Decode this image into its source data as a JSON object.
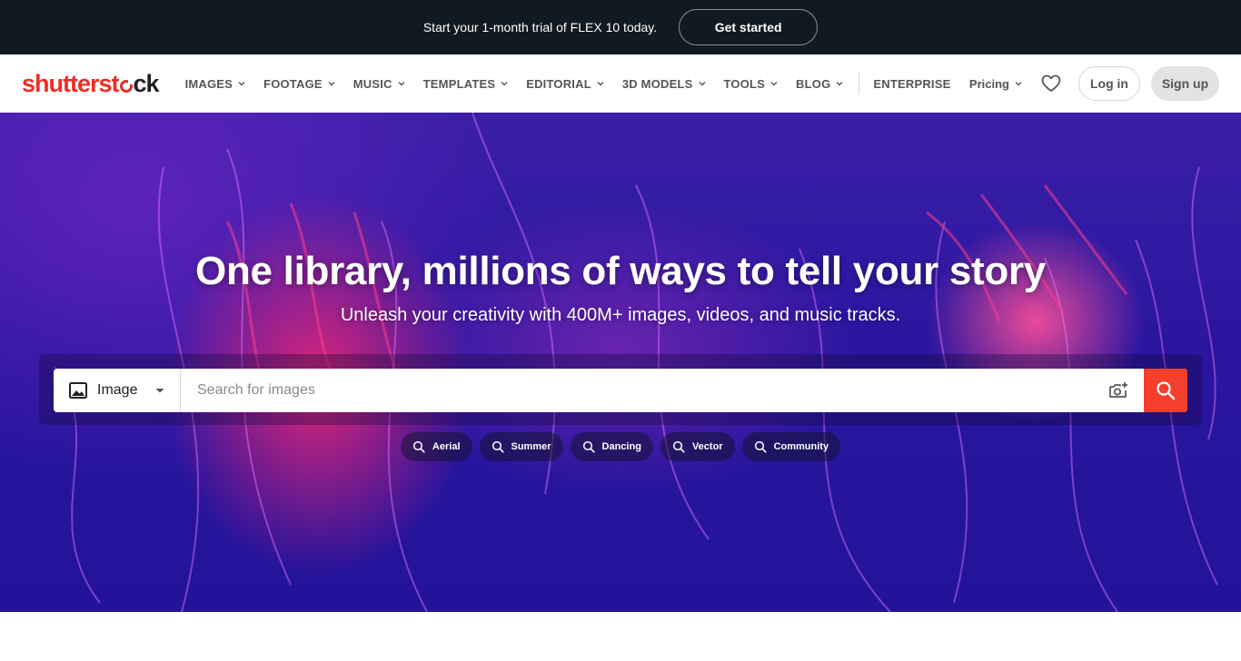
{
  "promo": {
    "text": "Start your 1-month trial of FLEX 10 today.",
    "button_label": "Get started"
  },
  "brand": {
    "logo_red_part": "shutterst",
    "logo_dark_part": "ck",
    "accent_color": "#ee2d24"
  },
  "nav": {
    "items": [
      {
        "label": "IMAGES",
        "has_dropdown": true
      },
      {
        "label": "FOOTAGE",
        "has_dropdown": true
      },
      {
        "label": "MUSIC",
        "has_dropdown": true
      },
      {
        "label": "TEMPLATES",
        "has_dropdown": true
      },
      {
        "label": "EDITORIAL",
        "has_dropdown": true
      },
      {
        "label": "3D MODELS",
        "has_dropdown": true
      },
      {
        "label": "TOOLS",
        "has_dropdown": true
      },
      {
        "label": "BLOG",
        "has_dropdown": true
      }
    ],
    "enterprise_label": "ENTERPRISE"
  },
  "header_right": {
    "pricing_label": "Pricing",
    "favorites_icon": "heart-icon",
    "login_label": "Log in",
    "signup_label": "Sign up"
  },
  "hero": {
    "title": "One library, millions of ways to tell your story",
    "subtitle": "Unleash your creativity with 400M+ images, videos, and music tracks."
  },
  "search": {
    "type_label": "Image",
    "type_icon": "image-icon",
    "placeholder": "Search for images",
    "camera_icon": "camera-search-icon",
    "submit_icon": "search-icon",
    "submit_color": "#f33f2b"
  },
  "suggestions": [
    "Aerial",
    "Summer",
    "Dancing",
    "Vector",
    "Community"
  ]
}
